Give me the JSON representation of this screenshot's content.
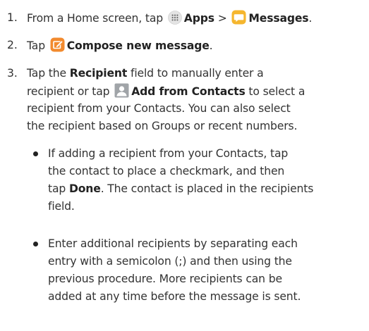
{
  "steps": [
    {
      "number": "1.",
      "pre": "From a Home screen, tap",
      "apps_icon": "apps-grid-icon",
      "apps_label": "Apps",
      "separator": ">",
      "messages_icon": "messages-icon",
      "messages_label": "Messages",
      "end": "."
    },
    {
      "number": "2.",
      "pre": "Tap",
      "compose_icon": "compose-icon",
      "compose_label": "Compose new message",
      "end": "."
    },
    {
      "number": "3.",
      "line1_pre": "Tap the",
      "recipient_label": "Recipient",
      "line1_post": "field to manually enter a",
      "line2_pre": "recipient or tap",
      "contacts_icon": "contacts-icon",
      "contacts_label": "Add from Contacts",
      "line2_post": "to select a",
      "line3": "recipient from your Contacts. You can also select",
      "line4": "the recipient based on Groups or recent numbers."
    }
  ],
  "bullets": [
    {
      "line1": "If adding a recipient from your Contacts, tap",
      "line2": "the contact to place a checkmark, and then",
      "line3_pre": "tap",
      "done_label": "Done",
      "line3_post": ". The contact is placed in the recipients",
      "line4": "field."
    },
    {
      "line1": "Enter additional recipients by separating each",
      "line2": "entry with a semicolon (;) and then using the",
      "line3": "previous procedure. More recipients can be",
      "line4": "added at any time before the message is sent."
    }
  ],
  "colors": {
    "text": "#333333",
    "apps_icon_bg": "#e4e4e4",
    "messages_icon": "#f5b62e",
    "compose_icon": "#f28a2e",
    "contacts_icon": "#a0a4a8"
  }
}
